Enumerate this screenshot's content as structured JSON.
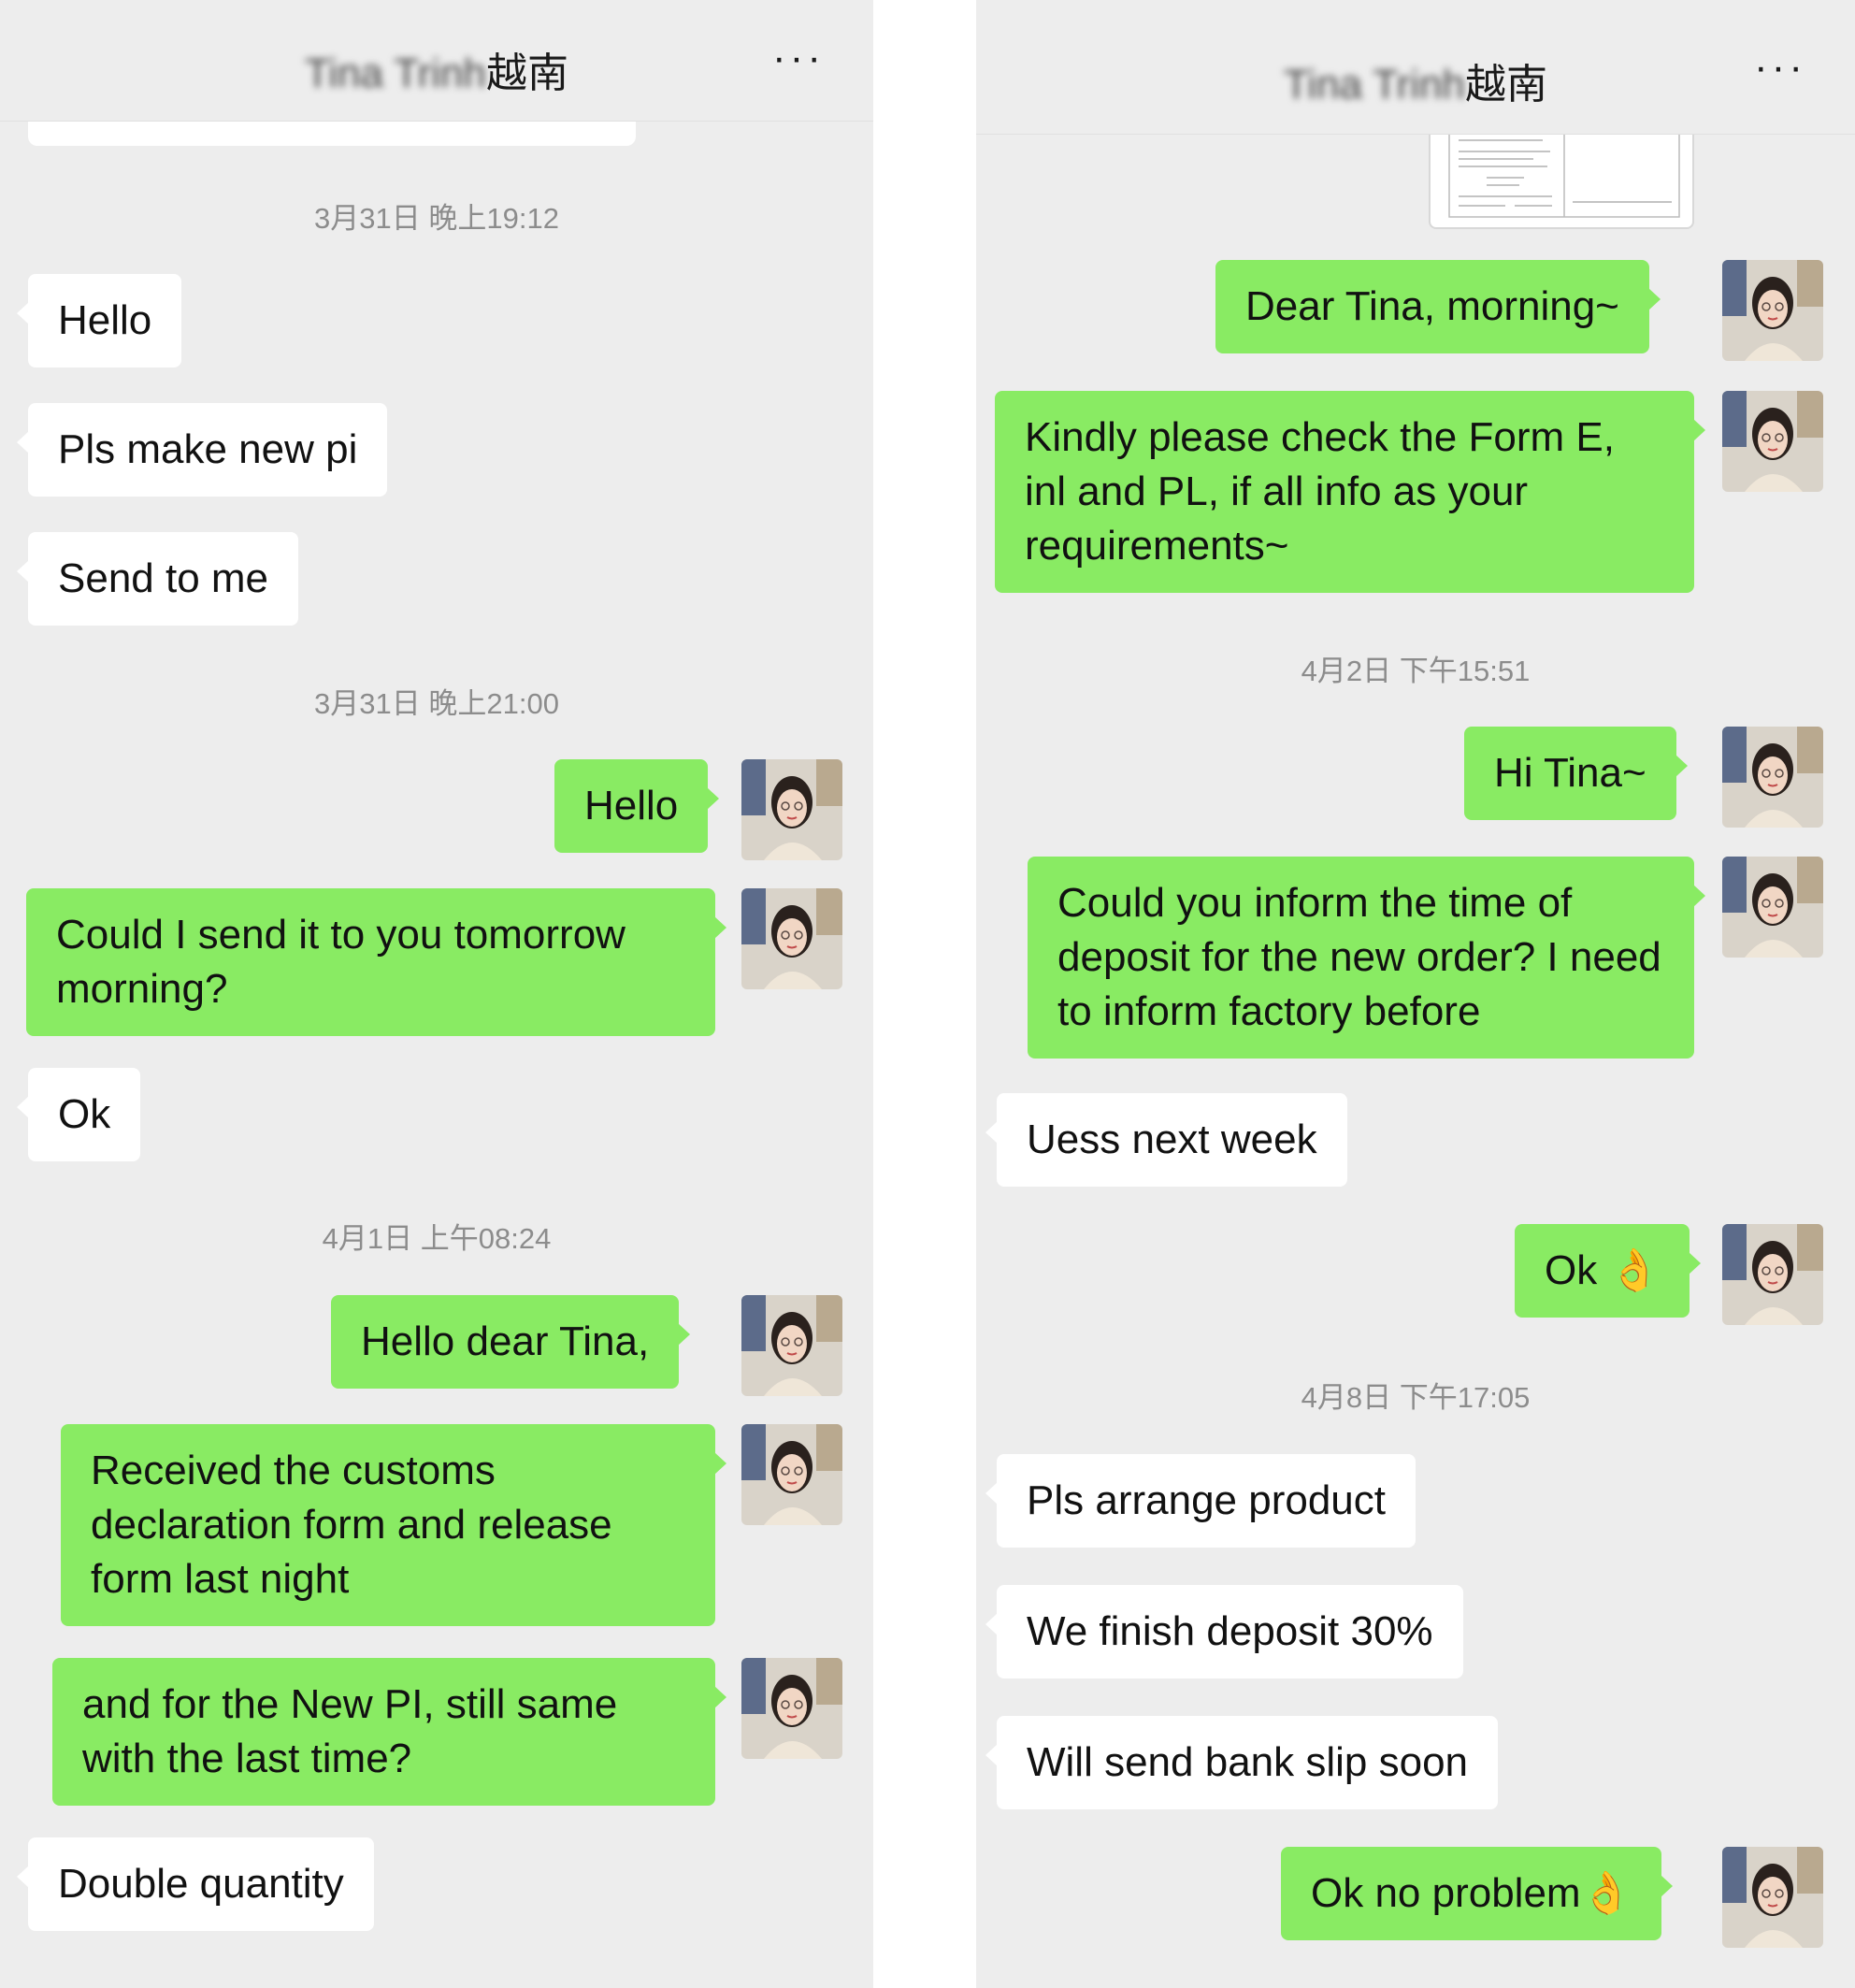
{
  "left": {
    "header": {
      "name_blurred": "Tina Trinh",
      "name_suffix": "越南",
      "more_icon": "more-dots-icon"
    },
    "timestamps": [
      "3月31日 晚上19:12",
      "3月31日 晚上21:00",
      "4月1日 上午08:24"
    ],
    "messages": [
      {
        "dir": "in",
        "text": "Hello"
      },
      {
        "dir": "in",
        "text": "Pls make new pi"
      },
      {
        "dir": "in",
        "text": "Send to me"
      },
      {
        "dir": "out",
        "text": "Hello"
      },
      {
        "dir": "out",
        "text": "Could I send it to you tomorrow morning?"
      },
      {
        "dir": "in",
        "text": "Ok"
      },
      {
        "dir": "out",
        "text": "Hello dear Tina,"
      },
      {
        "dir": "out",
        "text": "Received the customs declaration form and release form last night"
      },
      {
        "dir": "out",
        "text": "and for the New PI, still same with the last time?"
      },
      {
        "dir": "in",
        "text": "Double quantity"
      }
    ]
  },
  "right": {
    "header": {
      "name_blurred": "Tina Trinh",
      "name_suffix": "越南",
      "more_icon": "more-dots-icon"
    },
    "timestamps": [
      "4月2日 下午15:51",
      "4月8日 下午17:05"
    ],
    "messages": [
      {
        "dir": "out",
        "text": "Dear Tina, morning~"
      },
      {
        "dir": "out",
        "text": "Kindly please check the Form E, inl and PL, if all info as your requirements~"
      },
      {
        "dir": "out",
        "text": "Hi Tina~"
      },
      {
        "dir": "out",
        "text": "Could you inform the time of deposit for the new order? I need to inform factory before"
      },
      {
        "dir": "in",
        "text": "Uess next week"
      },
      {
        "dir": "out",
        "text": "Ok 👌"
      },
      {
        "dir": "in",
        "text": "Pls arrange product"
      },
      {
        "dir": "in",
        "text": "We finish deposit 30%"
      },
      {
        "dir": "in",
        "text": "Will send bank slip soon"
      },
      {
        "dir": "out",
        "text": "Ok no problem👌"
      }
    ]
  },
  "colors": {
    "background": "#ededed",
    "outgoing_bubble": "#89eb63",
    "incoming_bubble": "#ffffff",
    "timestamp_text": "#8c8c8c"
  }
}
